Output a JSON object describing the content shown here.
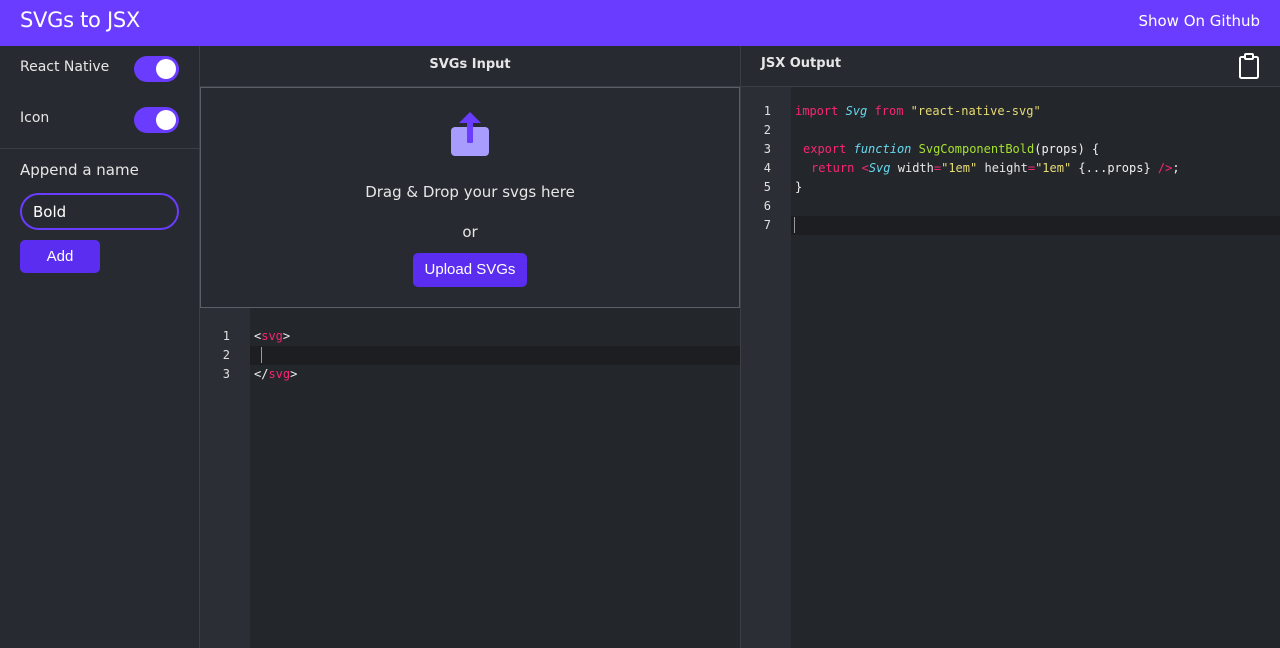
{
  "header": {
    "title": "SVGs to JSX",
    "github_link": "Show On Github",
    "bg_color": "#6a3cff"
  },
  "sidebar": {
    "react_native": {
      "label": "React Native",
      "enabled": true
    },
    "icon": {
      "label": "Icon",
      "enabled": true
    },
    "append_label": "Append a name",
    "name_value": "Bold",
    "add_label": "Add"
  },
  "input_panel": {
    "title": "SVGs Input",
    "icon": "upload-icon",
    "drop_text": "Drag & Drop your svgs here",
    "or_text": "or",
    "upload_label": "Upload SVGs",
    "code": {
      "line_numbers": [
        "1",
        "2",
        "3"
      ],
      "line1": {
        "open": "<",
        "tag": "svg",
        "close": ">"
      },
      "line2": "",
      "line3": {
        "open": "</",
        "tag": "svg",
        "close": ">"
      }
    }
  },
  "output_panel": {
    "title": "JSX Output",
    "copy_icon": "clipboard-icon",
    "code": {
      "line_numbers": [
        "1",
        "2",
        "3",
        "4",
        "5",
        "6",
        "7"
      ],
      "line1": {
        "kw1": "import",
        "type": "Svg",
        "kw2": "from",
        "str": "\"react-native-svg\""
      },
      "line3": {
        "kw": "export",
        "fnkw": "function",
        "name": "SvgComponentBold",
        "params": "(props) {"
      },
      "line4": {
        "kw": "return",
        "lt": "<",
        "type": "Svg",
        "attr1": "width",
        "eq1": "=",
        "val1": "\"1em\"",
        "attr2": "height",
        "eq2": "=",
        "val2": "\"1em\"",
        "spread": "{...props}",
        "close": "/>",
        "semi": ";"
      },
      "line5": "}"
    }
  },
  "accent_color": "#6a3cff",
  "syntax_colors": {
    "keyword": "#f92672",
    "type": "#66d9ef",
    "string": "#e6db74",
    "function": "#a6e22e"
  }
}
